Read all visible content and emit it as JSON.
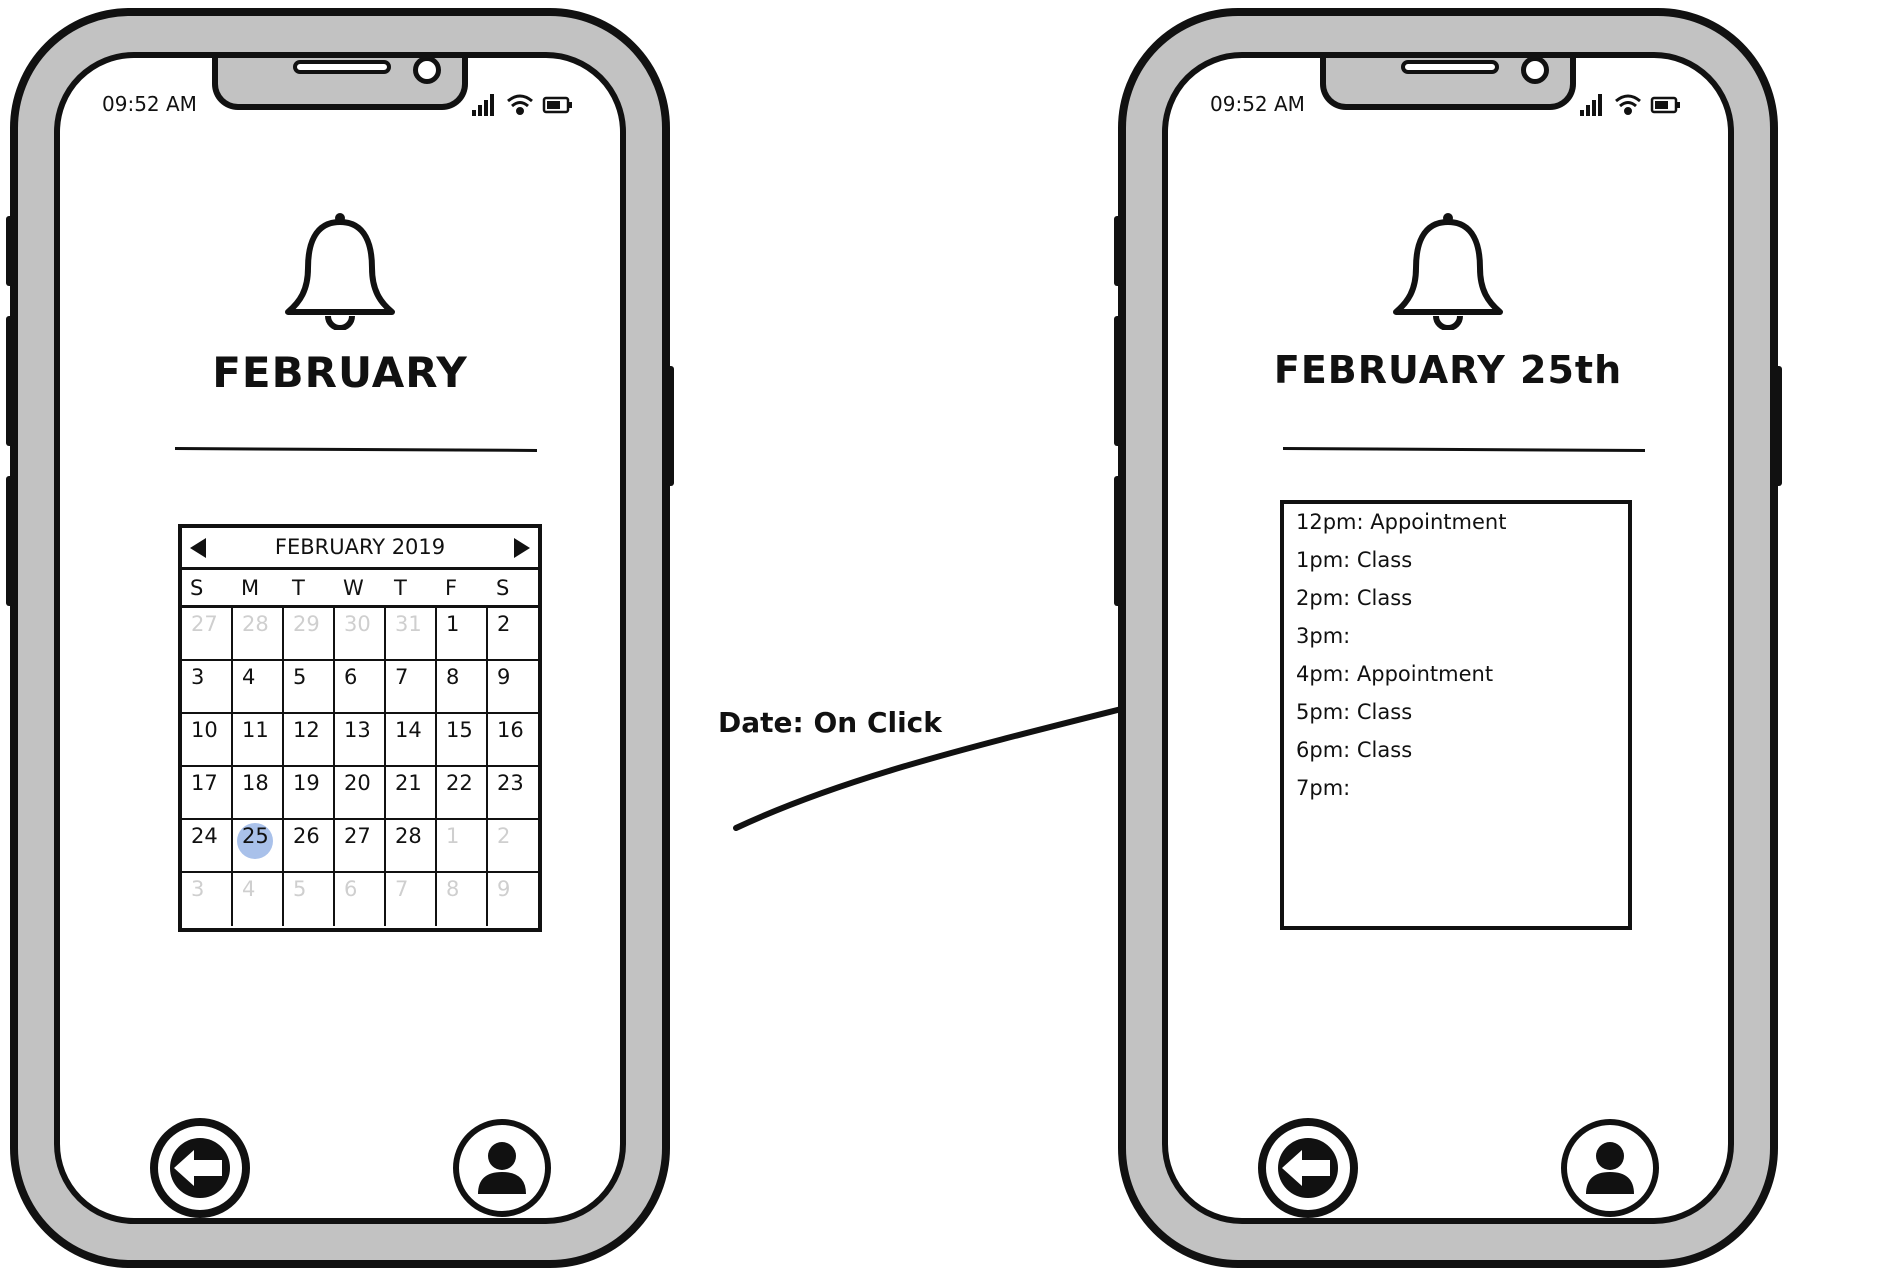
{
  "annotation": {
    "label": "Date: On Click"
  },
  "left_phone": {
    "status_time": "09:52 AM",
    "title": "FEBRUARY",
    "calendar": {
      "header": "FEBRUARY 2019",
      "weekdays": [
        "S",
        "M",
        "T",
        "W",
        "T",
        "F",
        "S"
      ],
      "weeks": [
        [
          "27",
          "28",
          "29",
          "30",
          "31",
          "1",
          "2"
        ],
        [
          "3",
          "4",
          "5",
          "6",
          "7",
          "8",
          "9"
        ],
        [
          "10",
          "11",
          "12",
          "13",
          "14",
          "15",
          "16"
        ],
        [
          "17",
          "18",
          "19",
          "20",
          "21",
          "22",
          "23"
        ],
        [
          "24",
          "25",
          "26",
          "27",
          "28",
          "1",
          "2"
        ],
        [
          "3",
          "4",
          "5",
          "6",
          "7",
          "8",
          "9"
        ]
      ],
      "muted": [
        [
          true,
          true,
          true,
          true,
          true,
          false,
          false
        ],
        [
          false,
          false,
          false,
          false,
          false,
          false,
          false
        ],
        [
          false,
          false,
          false,
          false,
          false,
          false,
          false
        ],
        [
          false,
          false,
          false,
          false,
          false,
          false,
          false
        ],
        [
          false,
          false,
          false,
          false,
          false,
          true,
          true
        ],
        [
          true,
          true,
          true,
          true,
          true,
          true,
          true
        ]
      ],
      "selected_date": "25",
      "selected_color": "#a9c1ea"
    },
    "nav": {
      "back_icon": "arrow-left-circle-icon",
      "profile_icon": "user-circle-icon"
    }
  },
  "right_phone": {
    "status_time": "09:52 AM",
    "title": "FEBRUARY 25th",
    "schedule": [
      "12pm: Appointment",
      "1pm: Class",
      "2pm: Class",
      "3pm:",
      "4pm: Appointment",
      "5pm: Class",
      "6pm: Class",
      "7pm:"
    ],
    "nav": {
      "back_icon": "arrow-left-circle-icon",
      "profile_icon": "user-circle-icon"
    }
  },
  "colors": {
    "phone_frame": "#c2c2c2",
    "outline": "#111111",
    "selected_day": "#a9c1ea",
    "muted_day": "#cfcfcf"
  }
}
